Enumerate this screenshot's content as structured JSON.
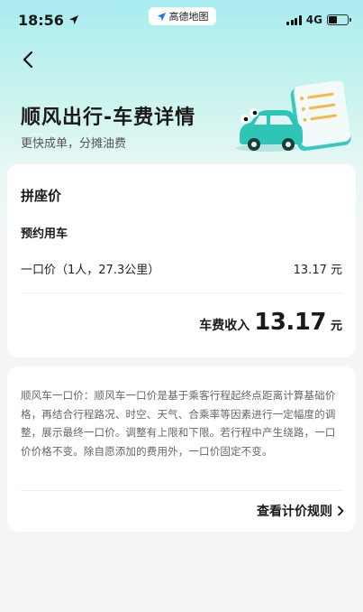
{
  "status_bar": {
    "time": "18:56",
    "app_pill": "高德地图",
    "network": "4G",
    "battery_level": 0.45
  },
  "header": {
    "title": "顺风出行-车费详情",
    "subtitle": "更快成单，分摊油费"
  },
  "price_card": {
    "section_title": "拼座价",
    "sub_title": "预约用车",
    "fare_label": "一口价（1人，27.3公里）",
    "fare_value": "13.17 元",
    "income_label": "车费收入",
    "income_amount": "13.17",
    "income_unit": "元"
  },
  "info_card": {
    "description": "顺风车一口价：顺风车一口价是基于乘客行程起终点距离计算基础价格，再结合行程路况、时空、天气、合乘率等因素进行一定幅度的调整，展示最终一口价。调整有上限和下限。若行程中产生绕路，一口价价格不变。除自愿添加的费用外，一口价固定不变。",
    "rules_link": "查看计价规则"
  },
  "colors": {
    "accent_teal": "#2ec4b6",
    "hero_gradient_top": "#a9ecef"
  },
  "icons": [
    "location-arrow-icon",
    "map-app-icon",
    "signal-icon",
    "battery-icon",
    "back-arrow-icon",
    "car-illustration",
    "chevron-right-icon"
  ]
}
